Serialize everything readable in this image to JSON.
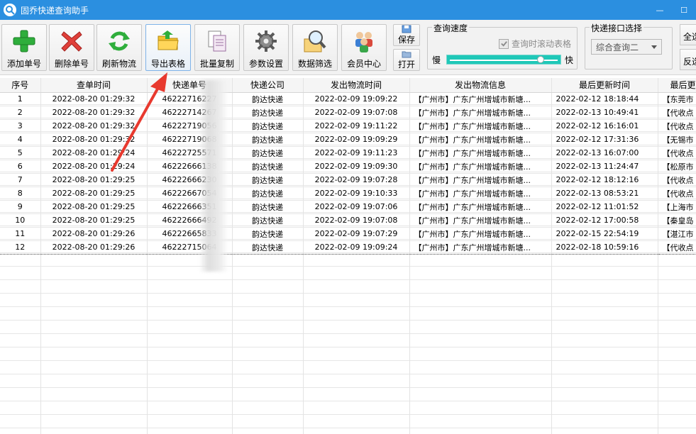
{
  "window": {
    "title": "固乔快递查询助手",
    "minimize": "—",
    "maximize": "☐"
  },
  "toolbar": {
    "add": "添加单号",
    "delete": "删除单号",
    "refresh": "刷新物流",
    "export": "导出表格",
    "batch_copy": "批量复制",
    "settings": "参数设置",
    "filter": "数据筛选",
    "member": "会员中心",
    "save": "保存",
    "open": "打开",
    "speed_group": "查询速度",
    "scroll_checkbox": "查询时滚动表格",
    "slow": "慢",
    "fast": "快",
    "speed_level": 0.86,
    "api_group": "快递接口选择",
    "api_selected": "综合查询二",
    "select_all": "全选",
    "invert": "反选"
  },
  "table": {
    "columns": [
      "序号",
      "查单时间",
      "快递单号",
      "快递公司",
      "发出物流时间",
      "发出物流信息",
      "最后更新时间",
      "最后更新"
    ],
    "rows": [
      [
        "1",
        "2022-08-20 01:29:32",
        "46222716227",
        "韵达快递",
        "2022-02-09 19:09:22",
        "【广州市】广东广州增城市新塘...",
        "2022-02-12 18:18:44",
        "【东莞市"
      ],
      [
        "2",
        "2022-08-20 01:29:32",
        "46222714267",
        "韵达快递",
        "2022-02-09 19:07:08",
        "【广州市】广东广州增城市新塘...",
        "2022-02-13 10:49:41",
        "【代收点"
      ],
      [
        "3",
        "2022-08-20 01:29:32",
        "46222719056",
        "韵达快递",
        "2022-02-09 19:11:22",
        "【广州市】广东广州增城市新塘...",
        "2022-02-12 16:16:01",
        "【代收点"
      ],
      [
        "4",
        "2022-08-20 01:29:32",
        "46222719068",
        "韵达快递",
        "2022-02-09 19:09:29",
        "【广州市】广东广州增城市新塘...",
        "2022-02-12 17:31:36",
        "【无锡市"
      ],
      [
        "5",
        "2022-08-20 01:29:24",
        "46222725571",
        "韵达快递",
        "2022-02-09 19:11:23",
        "【广州市】广东广州增城市新塘...",
        "2022-02-13 16:07:00",
        "【代收点"
      ],
      [
        "6",
        "2022-08-20 01:29:24",
        "46222666138",
        "韵达快递",
        "2022-02-09 19:09:30",
        "【广州市】广东广州增城市新塘...",
        "2022-02-13 11:24:47",
        "【松原市"
      ],
      [
        "7",
        "2022-08-20 01:29:25",
        "46222666230",
        "韵达快递",
        "2022-02-09 19:07:28",
        "【广州市】广东广州增城市新塘...",
        "2022-02-12 18:12:16",
        "【代收点"
      ],
      [
        "8",
        "2022-08-20 01:29:25",
        "46222667054",
        "韵达快递",
        "2022-02-09 19:10:33",
        "【广州市】广东广州增城市新塘...",
        "2022-02-13 08:53:21",
        "【代收点"
      ],
      [
        "9",
        "2022-08-20 01:29:25",
        "46222666351",
        "韵达快递",
        "2022-02-09 19:07:06",
        "【广州市】广东广州增城市新塘...",
        "2022-02-12 11:01:52",
        "【上海市"
      ],
      [
        "10",
        "2022-08-20 01:29:25",
        "46222666492",
        "韵达快递",
        "2022-02-09 19:07:08",
        "【广州市】广东广州增城市新塘...",
        "2022-02-12 17:00:58",
        "【秦皇岛"
      ],
      [
        "11",
        "2022-08-20 01:29:26",
        "46222665833",
        "韵达快递",
        "2022-02-09 19:07:29",
        "【广州市】广东广州增城市新塘...",
        "2022-02-15 22:54:19",
        "【湛江市"
      ],
      [
        "12",
        "2022-08-20 01:29:26",
        "46222715064",
        "韵达快递",
        "2022-02-09 19:09:24",
        "【广州市】广东广州增城市新塘...",
        "2022-02-18 10:59:16",
        "【代收点"
      ]
    ]
  },
  "colors": {
    "titlebar": "#2b8fe0",
    "slider": "#1fc8b8",
    "arrow": "#e8392e"
  }
}
